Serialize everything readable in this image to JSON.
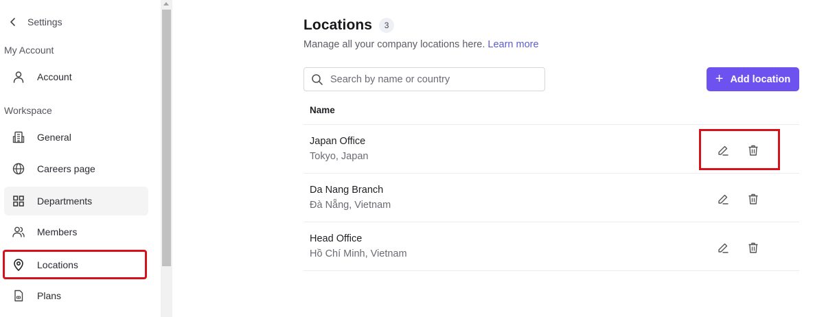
{
  "sidebar": {
    "back_label": "Settings",
    "sections": {
      "my_account": "My Account",
      "workspace": "Workspace"
    },
    "items": [
      {
        "label": "Account",
        "icon": "user-icon"
      },
      {
        "label": "General",
        "icon": "building-icon"
      },
      {
        "label": "Careers page",
        "icon": "globe-icon"
      },
      {
        "label": "Departments",
        "icon": "grid-icon"
      },
      {
        "label": "Members",
        "icon": "users-icon"
      },
      {
        "label": "Locations",
        "icon": "map-pin-icon"
      },
      {
        "label": "Plans",
        "icon": "document-icon"
      }
    ]
  },
  "main": {
    "title": "Locations",
    "count": "3",
    "subtitle": "Manage all your company locations here.",
    "learn_more": "Learn more",
    "search": {
      "placeholder": "Search by name or country",
      "value": ""
    },
    "add_button": "Add location",
    "table": {
      "column_name": "Name",
      "rows": [
        {
          "name": "Japan Office",
          "location": "Tokyo, Japan"
        },
        {
          "name": "Da Nang Branch",
          "location": "Đà Nẵng, Vietnam"
        },
        {
          "name": "Head Office",
          "location": "Hồ Chí Minh, Vietnam"
        }
      ]
    }
  },
  "colors": {
    "accent": "#6d52f0",
    "link": "#5b5bd6",
    "highlight": "#d6111a"
  }
}
